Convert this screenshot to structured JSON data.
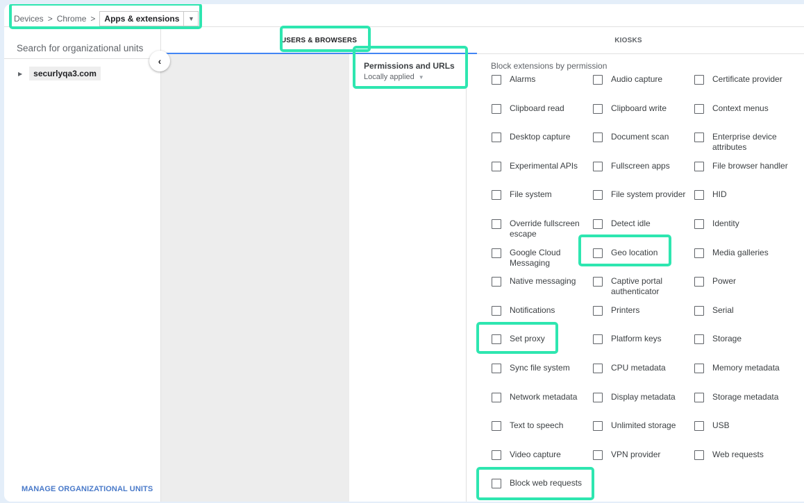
{
  "breadcrumb": {
    "items": [
      "Devices",
      "Chrome"
    ],
    "current": "Apps & extensions"
  },
  "left_panel": {
    "search_placeholder": "Search for organizational units",
    "org_unit": "securlyqa3.com",
    "manage_label": "MANAGE ORGANIZATIONAL UNITS"
  },
  "tabs": [
    {
      "label": "USERS & BROWSERS",
      "active": true
    },
    {
      "label": "KIOSKS",
      "active": false
    }
  ],
  "setting": {
    "title": "Permissions and URLs",
    "status": "Locally applied"
  },
  "permissions": {
    "heading": "Block extensions by permission",
    "items": [
      "Alarms",
      "Audio capture",
      "Certificate provider",
      "Clipboard read",
      "Clipboard write",
      "Context menus",
      "Desktop capture",
      "Document scan",
      "Enterprise device attributes",
      "Experimental APIs",
      "Fullscreen apps",
      "File browser handler",
      "File system",
      "File system provider",
      "HID",
      "Override fullscreen escape",
      "Detect idle",
      "Identity",
      "Google Cloud Messaging",
      "Geo location",
      "Media galleries",
      "Native messaging",
      "Captive portal authenticator",
      "Power",
      "Notifications",
      "Printers",
      "Serial",
      "Set proxy",
      "Platform keys",
      "Storage",
      "Sync file system",
      "CPU metadata",
      "Memory metadata",
      "Network metadata",
      "Display metadata",
      "Storage metadata",
      "Text to speech",
      "Unlimited storage",
      "USB",
      "Video capture",
      "VPN provider",
      "Web requests",
      "Block web requests"
    ]
  },
  "colors": {
    "highlight": "#2ee6b0",
    "tab_indicator": "#4285f4",
    "link": "#4a7ac9"
  }
}
